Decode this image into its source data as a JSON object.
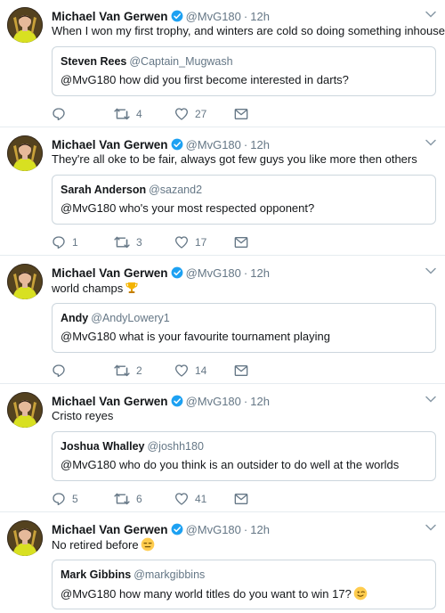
{
  "colors": {
    "verified": "#1da1f2",
    "icon": "#657786",
    "border": "#e6ecf0"
  },
  "icons": {
    "reply": "reply-icon",
    "retweet": "retweet-icon",
    "like": "heart-icon",
    "dm": "envelope-icon",
    "verified": "verified-badge-icon",
    "caret": "chevron-down-icon"
  },
  "tweets": [
    {
      "author": "Michael Van Gerwen",
      "handle": "@MvG180",
      "time": "12h",
      "text": "When I won my first trophy, and winters are cold so doing something inhouse",
      "emoji": "",
      "quote": {
        "author": "Steven Rees",
        "handle": "@Captain_Mugwash",
        "text": "@MvG180 how did you first become interested in darts?",
        "emoji": ""
      },
      "replies": "",
      "retweets": "4",
      "likes": "27"
    },
    {
      "author": "Michael Van Gerwen",
      "handle": "@MvG180",
      "time": "12h",
      "text": "They're all oke to be fair, always got few guys you like more then others",
      "emoji": "",
      "quote": {
        "author": "Sarah Anderson",
        "handle": "@sazand2",
        "text": "@MvG180 who's your most respected opponent?",
        "emoji": ""
      },
      "replies": "1",
      "retweets": "3",
      "likes": "17"
    },
    {
      "author": "Michael Van Gerwen",
      "handle": "@MvG180",
      "time": "12h",
      "text": "world champs",
      "emoji": "trophy",
      "quote": {
        "author": "Andy",
        "handle": "@AndyLowery1",
        "text": "@MvG180 what is your favourite tournament playing",
        "emoji": ""
      },
      "replies": "",
      "retweets": "2",
      "likes": "14"
    },
    {
      "author": "Michael Van Gerwen",
      "handle": "@MvG180",
      "time": "12h",
      "text": "Cristo reyes",
      "emoji": "",
      "quote": {
        "author": "Joshua Whalley",
        "handle": "@joshh180",
        "text": "@MvG180 who do you think is an outsider to do well at the worlds",
        "emoji": ""
      },
      "replies": "5",
      "retweets": "6",
      "likes": "41"
    },
    {
      "author": "Michael Van Gerwen",
      "handle": "@MvG180",
      "time": "12h",
      "text": "No retired before",
      "emoji": "expressionless",
      "quote": {
        "author": "Mark Gibbins",
        "handle": "@markgibbins",
        "text": "@MvG180 how many world titles do you want to win 17?",
        "emoji": "wink"
      },
      "replies": "",
      "retweets": "",
      "likes": ""
    }
  ]
}
